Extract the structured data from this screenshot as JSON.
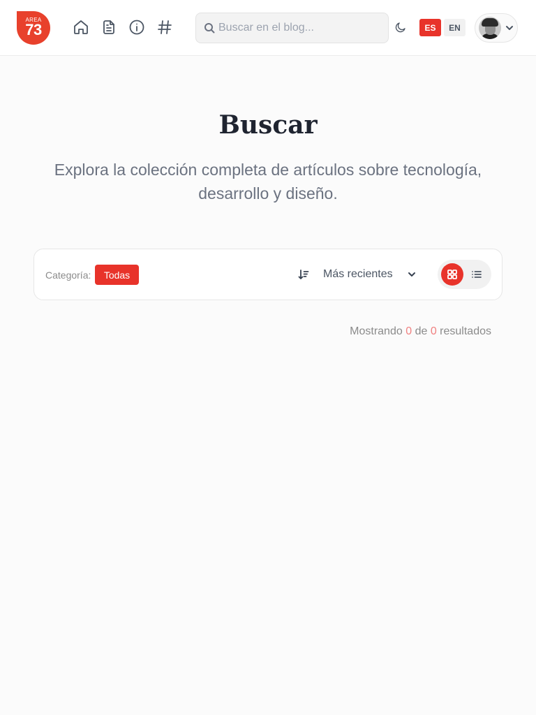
{
  "header": {
    "logo": {
      "top_text": "AREA",
      "main_text": "73"
    },
    "nav": [
      {
        "name": "home-icon",
        "label": "Inicio"
      },
      {
        "name": "document-icon",
        "label": "Artículos"
      },
      {
        "name": "info-icon",
        "label": "Acerca de"
      },
      {
        "name": "hashtag-icon",
        "label": "Etiquetas"
      }
    ],
    "search": {
      "placeholder": "Buscar en el blog...",
      "value": ""
    },
    "theme_icon": "moon-icon",
    "languages": [
      {
        "code": "ES",
        "active": true
      },
      {
        "code": "EN",
        "active": false
      }
    ],
    "user_menu_icon": "chevron-down-icon"
  },
  "hero": {
    "title": "Buscar",
    "subtitle": "Explora la colección completa de artículos sobre tecnología, desarrollo y diseño."
  },
  "filters": {
    "category_label": "Categoría:",
    "active_category": "Todas",
    "sort_icon": "sort-descending-icon",
    "sort_value": "Más recientes",
    "view_modes": [
      {
        "name": "grid",
        "active": true
      },
      {
        "name": "list",
        "active": false
      }
    ]
  },
  "results": {
    "prefix": "Mostrando",
    "shown": "0",
    "middle": "de",
    "total": "0",
    "suffix": "resultados"
  },
  "colors": {
    "accent": "#e8332a",
    "logo": "#e8412c",
    "background": "#fbfbfb"
  }
}
